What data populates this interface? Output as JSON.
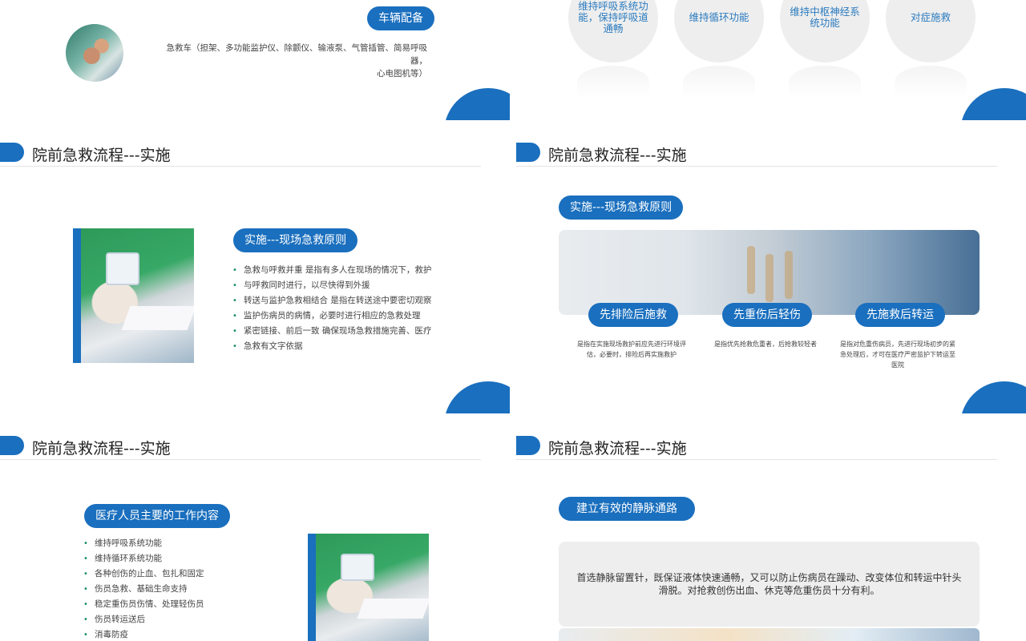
{
  "slide1": {
    "vehicle_label": "车辆配备",
    "ambulance_lines": [
      "急救车（担架、多功能监护仪、除颤仪、输液泵、气管插管、简易呼吸器，",
      "心电图机等）"
    ]
  },
  "slide2": {
    "circles": [
      {
        "label": "维持呼吸系统功能，保持呼吸道通畅"
      },
      {
        "label": "维持循环功能"
      },
      {
        "label": "维持中枢神经系统功能"
      },
      {
        "label": "对症施救"
      }
    ]
  },
  "slide3": {
    "title": "院前急救流程---实施",
    "pill": "实施---现场急救原则",
    "bullets": [
      "急救与呼救并重    是指有多人在现场的情况下，救护",
      "与呼救同时进行，以尽快得到外援",
      "转送与监护急救相结合    是指在转送途中要密切观察",
      "监护伤病员的病情，必要时进行相应的急救处理",
      "紧密链接、前后一致    确保现场急救措施完善、医疗",
      "急救有文字依据"
    ]
  },
  "slide4": {
    "title": "院前急救流程---实施",
    "pill": "实施---现场急救原则",
    "principles": [
      {
        "label": "先排险后施救",
        "desc": "是指在实施现场救护前应先进行环境评估，必要时，排险后再实施救护"
      },
      {
        "label": "先重伤后轻伤",
        "desc": "是指优先抢救危重者，后抢救较轻者"
      },
      {
        "label": "先施救后转运",
        "desc": "是指对危重伤病员，先进行现场初步的紧急处理后，才可在医疗严密监护下转运至医院"
      }
    ]
  },
  "slide5": {
    "title": "院前急救流程---实施",
    "pill": "医疗人员主要的工作内容",
    "items": [
      "维持呼吸系统功能",
      "维持循环系统功能",
      "各种创伤的止血、包扎和固定",
      "伤员急救、基础生命支持",
      "稳定重伤员伤情、处理轻伤员",
      "伤员转运送后",
      "消毒防疫"
    ]
  },
  "slide6": {
    "title": "院前急救流程---实施",
    "pill": "建立有效的静脉通路",
    "note_lines": [
      "首选静脉留置针，既保证液体快速通畅，又可以防止伤病员在躁动、改变体位和转运中针头",
      "滑脱。对抢救创伤出血、休克等危重伤员十分有利。"
    ]
  },
  "colors": {
    "accent": "#1a6fbe",
    "circle_bg": "#eeeeee",
    "circle_text": "#2b7bbf"
  }
}
